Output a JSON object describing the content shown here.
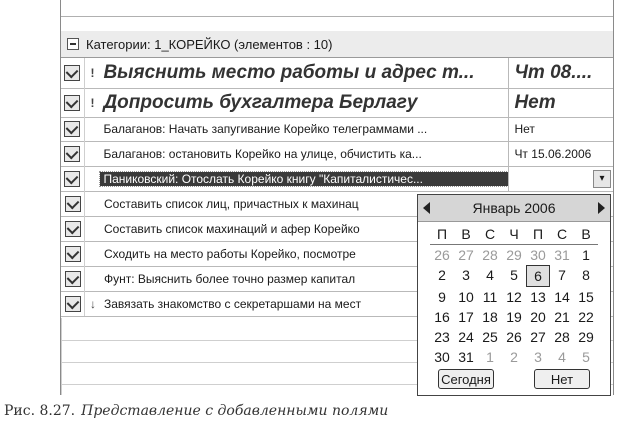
{
  "group": {
    "label": "Категории: 1_КОРЕЙКО (элементов : 10)"
  },
  "rows": [
    {
      "subject": "Выяснить место работы и адрес т...",
      "date": "Чт 08....",
      "flag": "!",
      "big": true
    },
    {
      "subject": "Допросить бухгалтера Берлагу",
      "date": "Нет",
      "flag": "!",
      "big": true
    },
    {
      "subject": "Балаганов: Начать запугивание Корейко телеграммами ...",
      "date": "Нет",
      "flag": "",
      "big": false
    },
    {
      "subject": "Балаганов: остановить Корейко на улице, обчистить ка...",
      "date": "Чт 15.06.2006",
      "flag": "",
      "big": false
    },
    {
      "subject": "Паниковский: Отослать Корейко книгу \"Капиталистичес...",
      "date": "",
      "flag": "",
      "big": false,
      "selected": true
    },
    {
      "subject": "Составить список лиц, причастных к махинац",
      "date": "",
      "flag": ""
    },
    {
      "subject": "Составить список махинаций и афер Корейко",
      "date": "",
      "flag": ""
    },
    {
      "subject": "Сходить на место работы Корейко, посмотре",
      "date": "",
      "flag": ""
    },
    {
      "subject": "Фунт: Выяснить более точно размер капитал",
      "date": "",
      "flag": ""
    },
    {
      "subject": "Завязать знакомство с секретаршами на мест",
      "date": "",
      "flag": "↓"
    }
  ],
  "calendar": {
    "title": "Январь 2006",
    "weekdays": [
      "П",
      "В",
      "С",
      "Ч",
      "П",
      "С",
      "В"
    ],
    "days": [
      [
        "26",
        "27",
        "28",
        "29",
        "30",
        "31",
        "1"
      ],
      [
        "2",
        "3",
        "4",
        "5",
        "6",
        "7",
        "8"
      ],
      [
        "9",
        "10",
        "11",
        "12",
        "13",
        "14",
        "15"
      ],
      [
        "16",
        "17",
        "18",
        "19",
        "20",
        "21",
        "22"
      ],
      [
        "23",
        "24",
        "25",
        "26",
        "27",
        "28",
        "29"
      ],
      [
        "30",
        "31",
        "1",
        "2",
        "3",
        "4",
        "5"
      ]
    ],
    "today_button": "Сегодня",
    "none_button": "Нет"
  },
  "caption": {
    "number": "Рис. 8.27.",
    "text": "Представление с добавленными полями"
  }
}
